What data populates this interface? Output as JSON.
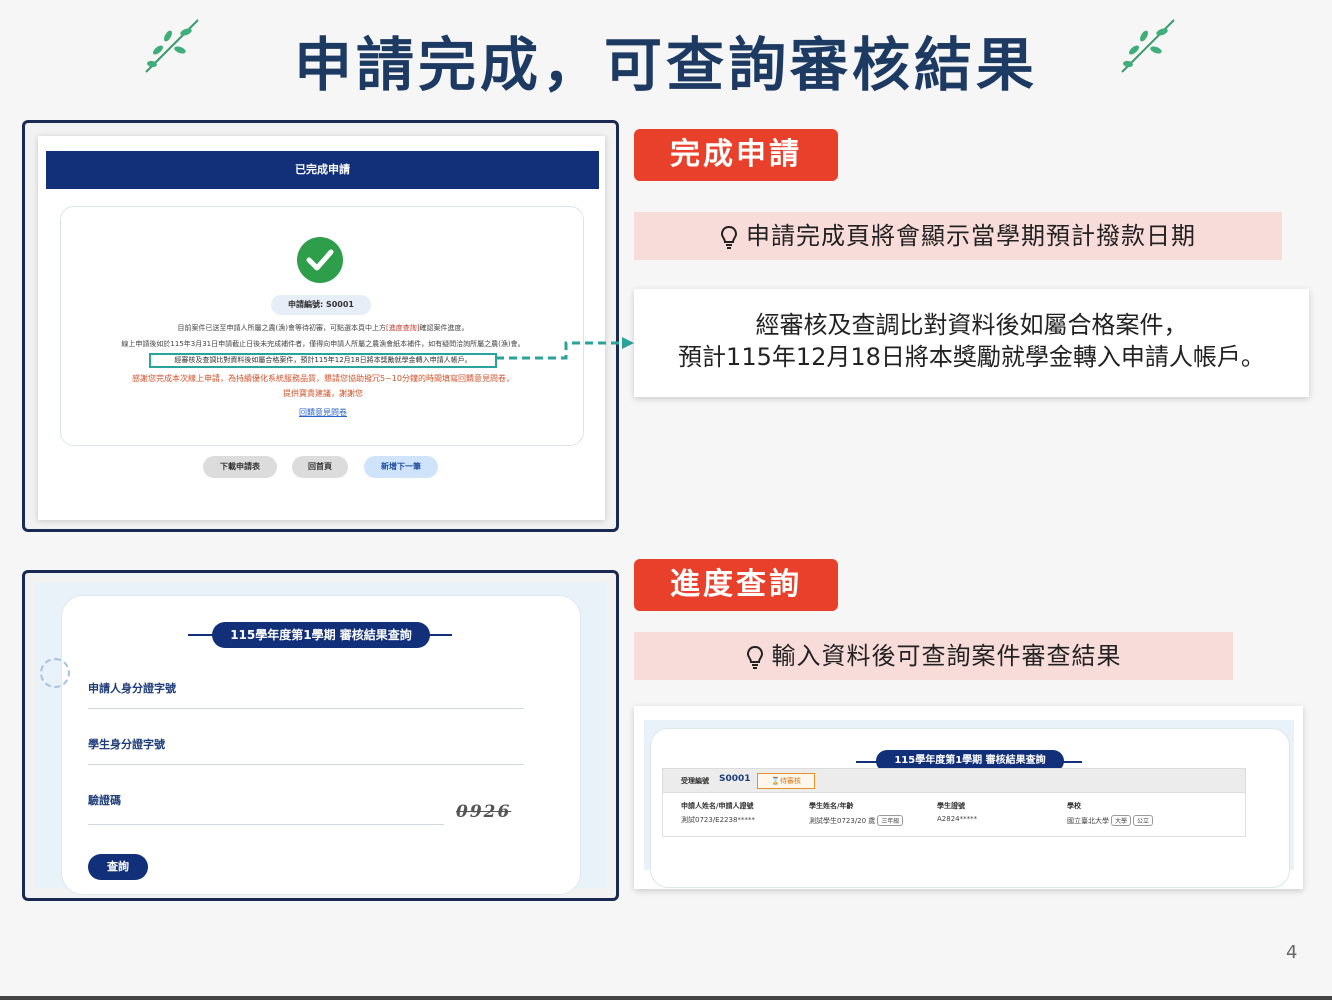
{
  "slide": {
    "title": "申請完成，可查詢審核結果",
    "page_number": "4"
  },
  "section1": {
    "tag": "完成申請",
    "note": "申請完成頁將會顯示當學期預計撥款日期",
    "callout_line1": "經審核及查調比對資料後如屬合格案件，",
    "callout_line2": "預計115年12月18日將本獎勵就學金轉入申請人帳戶。"
  },
  "completion_screen": {
    "header": "已完成申請",
    "application_no": "申請編號: S0001",
    "line1_pre": "目前案件已送至申請人所屬之農(漁)會等待初審，可點選本頁中上方",
    "line1_link": "[進度查詢]",
    "line1_post": "確認案件進度。",
    "line2": "線上申請後如於115年3月31日申請截止日後未完成補件者，僅得向申請人所屬之農漁會紙本補件，如有疑問洽詢所屬之農(漁)會。",
    "line3": "經審核及查調比對資料後如屬合格案件，預計115年12月18日將本獎勵就學金轉入申請人帳戶。",
    "thanks_line1": "感謝您完成本次線上申請，為持續優化系統服務品質，懇請您協助撥冗5~10分鐘的時間填寫回饋意見問卷，",
    "thanks_line2": "提供寶貴建議，謝謝您",
    "survey_link": "回饋意見問卷",
    "buttons": {
      "download": "下載申請表",
      "home": "回首頁",
      "new": "新增下一筆"
    }
  },
  "section2": {
    "tag": "進度查詢",
    "note": "輸入資料後可查詢案件審查結果"
  },
  "query_form": {
    "title": "115學年度第1學期 審核結果查詢",
    "field_applicant_id": "申請人身分證字號",
    "field_student_id": "學生身分證字號",
    "field_captcha": "驗證碼",
    "captcha_text": "0926",
    "submit": "查詢"
  },
  "query_result": {
    "title": "115學年度第1學期 審核結果查詢",
    "case_label": "受理編號",
    "case_no": "S0001",
    "status": "⌛待審核",
    "columns": [
      {
        "header": "申請人姓名/申請人證號",
        "value": "測試0723/E2238*****",
        "badges": []
      },
      {
        "header": "學生姓名/年齡",
        "value": "測試學生0723/20 歲",
        "badges": [
          "三年級"
        ]
      },
      {
        "header": "學生證號",
        "value": "A2824*****",
        "badges": []
      },
      {
        "header": "學校",
        "value": "國立臺北大學",
        "badges": [
          "大學",
          "公立"
        ]
      }
    ]
  }
}
